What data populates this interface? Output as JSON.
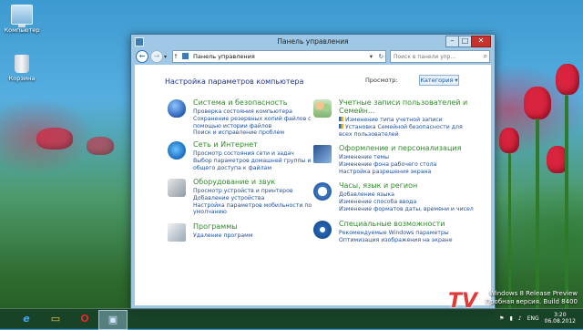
{
  "desktop": {
    "icons": [
      {
        "label": "Компьютер",
        "icon": "computer-icon"
      },
      {
        "label": "Корзина",
        "icon": "recycle-bin-icon"
      }
    ],
    "watermark_line1": "Windows 8 Release Preview",
    "watermark_line2": "Пробная версия. Build 8400",
    "tv_logo": "TV"
  },
  "window": {
    "title": "Панель управления",
    "minimize": "–",
    "maximize": "□",
    "close": "✕",
    "address": "Панель управления",
    "search_placeholder": "Поиск в панели упр...",
    "heading": "Настройка параметров компьютера",
    "viewby_label": "Просмотр:",
    "viewby_value": "Категория ▾"
  },
  "categories_left": [
    {
      "title": "Система и безопасность",
      "icon": "shield-icon",
      "links": [
        "Проверка состояния компьютера",
        "Сохранение резервных копий файлов с",
        "помощью истории файлов",
        "Поиск и исправление проблем"
      ]
    },
    {
      "title": "Сеть и Интернет",
      "icon": "network-globe-icon",
      "links": [
        "Просмотр состояния сети и задач",
        "Выбор параметров домашней группы и",
        "общего доступа к файлам"
      ]
    },
    {
      "title": "Оборудование и звук",
      "icon": "printer-icon",
      "links": [
        "Просмотр устройств и принтеров",
        "Добавление устройства",
        "Настройка параметров мобильности по",
        "умолчанию"
      ]
    },
    {
      "title": "Программы",
      "icon": "programs-icon",
      "links": [
        "Удаление программ"
      ]
    }
  ],
  "categories_right": [
    {
      "title": "Учетные записи пользователей и",
      "title2": "Семейн...",
      "icon": "users-icon",
      "links": [
        "Изменение типа учетной записи",
        "Установка Семейной безопасности для",
        "всех пользователей"
      ],
      "shield_links": [
        0,
        1
      ]
    },
    {
      "title": "Оформление и персонализация",
      "icon": "appearance-icon",
      "links": [
        "Изменение темы",
        "Изменение фона рабочего стола",
        "Настройка разрешения экрана"
      ]
    },
    {
      "title": "Часы, язык и регион",
      "icon": "clock-globe-icon",
      "links": [
        "Добавление языка",
        "Изменение способа ввода",
        "Изменение форматов даты, времени и чисел"
      ]
    },
    {
      "title": "Специальные возможности",
      "icon": "accessibility-icon",
      "links": [
        "Рекомендуемые Windows параметры",
        "Оптимизация изображения на экране"
      ]
    }
  ],
  "taskbar": {
    "items": [
      {
        "name": "internet-explorer-icon",
        "glyph": "e"
      },
      {
        "name": "file-explorer-icon",
        "glyph": "▭"
      },
      {
        "name": "opera-icon",
        "glyph": "O"
      },
      {
        "name": "control-panel-taskbar-icon",
        "glyph": "▣"
      }
    ],
    "language": "ENG",
    "time": "3:20",
    "date": "06.08.2012"
  }
}
